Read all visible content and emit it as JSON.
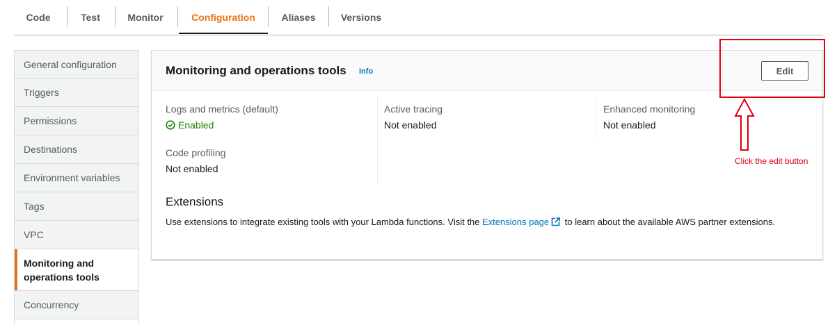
{
  "tabs": [
    {
      "label": "Code"
    },
    {
      "label": "Test"
    },
    {
      "label": "Monitor"
    },
    {
      "label": "Configuration",
      "active": true
    },
    {
      "label": "Aliases"
    },
    {
      "label": "Versions"
    }
  ],
  "sidebar": {
    "items": [
      {
        "label": "General configuration"
      },
      {
        "label": "Triggers"
      },
      {
        "label": "Permissions"
      },
      {
        "label": "Destinations"
      },
      {
        "label": "Environment variables"
      },
      {
        "label": "Tags"
      },
      {
        "label": "VPC"
      },
      {
        "label": "Monitoring and operations tools",
        "active": true
      },
      {
        "label": "Concurrency"
      }
    ]
  },
  "panel": {
    "title": "Monitoring and operations tools",
    "info": "Info",
    "edit_label": "Edit",
    "fields": {
      "logs_label": "Logs and metrics (default)",
      "logs_value": "Enabled",
      "tracing_label": "Active tracing",
      "tracing_value": "Not enabled",
      "enhanced_label": "Enhanced monitoring",
      "enhanced_value": "Not enabled",
      "profiling_label": "Code profiling",
      "profiling_value": "Not enabled"
    },
    "extensions": {
      "heading": "Extensions",
      "text_before": "Use extensions to integrate existing tools with your Lambda functions. Visit the ",
      "link": "Extensions page",
      "text_after": " to learn about the available AWS partner extensions."
    }
  },
  "annotation": {
    "text": "Click the edit button",
    "color": "#e0000f"
  },
  "colors": {
    "accent": "#ec7211",
    "link": "#0073bb",
    "success": "#1d8102"
  },
  "icons": {
    "enabled": "check-circle-icon",
    "external": "external-link-icon",
    "arrow": "up-arrow-icon"
  }
}
